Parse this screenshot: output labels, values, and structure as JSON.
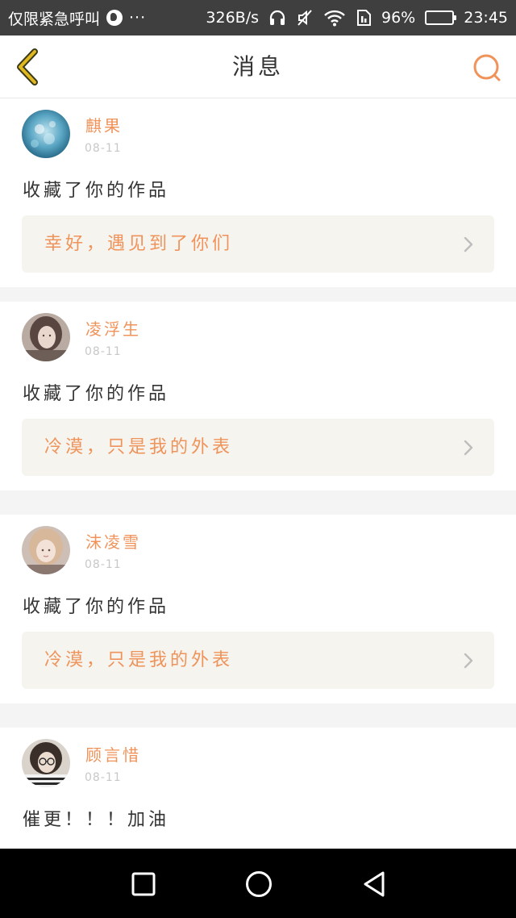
{
  "status_bar": {
    "carrier": "仅限紧急呼叫",
    "more": "···",
    "net_speed": "326B/s",
    "battery_percent": "96%",
    "time": "23:45"
  },
  "header": {
    "title": "消息"
  },
  "colors": {
    "accent": "#f0935a",
    "back_icon": "#e0b820",
    "card_link_bg": "#f5f4ef"
  },
  "messages": [
    {
      "user": "麒果",
      "date": "08-11",
      "text": "收藏了你的作品",
      "work_title": "幸好，遇见到了你们",
      "avatar": "blue-bokeh-avatar"
    },
    {
      "user": "凌浮生",
      "date": "08-11",
      "text": "收藏了你的作品",
      "work_title": "冷漠，只是我的外表",
      "avatar": "girl-portrait-avatar"
    },
    {
      "user": "沫凌雪",
      "date": "08-11",
      "text": "收藏了你的作品",
      "work_title": "冷漠，只是我的外表",
      "avatar": "blonde-girl-avatar"
    },
    {
      "user": "顾言惜",
      "date": "08-11",
      "text": "催更！！！加油",
      "work_title": "",
      "avatar": "glasses-girl-avatar"
    }
  ]
}
